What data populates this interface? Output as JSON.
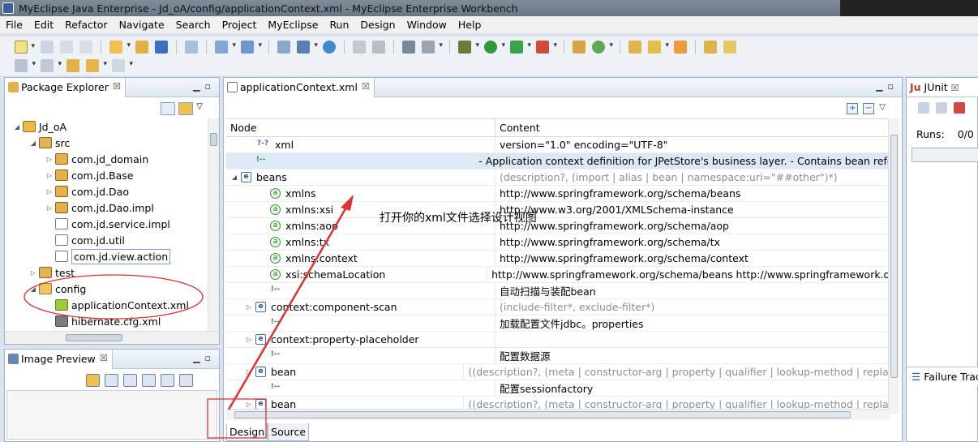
{
  "window": {
    "title": "MyEclipse Java Enterprise - Jd_oA/config/applicationContext.xml - MyEclipse Enterprise Workbench"
  },
  "menu": [
    "File",
    "Edit",
    "Refactor",
    "Navigate",
    "Search",
    "Project",
    "MyEclipse",
    "Run",
    "Design",
    "Window",
    "Help"
  ],
  "package_explorer": {
    "title": "Package Explorer",
    "close": "☒",
    "tree": [
      {
        "label": "Jd_oA",
        "indent": 0,
        "twisty": "◢",
        "icon": "project"
      },
      {
        "label": "src",
        "indent": 1,
        "twisty": "◢",
        "icon": "src"
      },
      {
        "label": "com.jd_domain",
        "indent": 2,
        "twisty": "▷",
        "icon": "pkg"
      },
      {
        "label": "com.jd.Base",
        "indent": 2,
        "twisty": "▷",
        "icon": "pkg"
      },
      {
        "label": "com.jd.Dao",
        "indent": 2,
        "twisty": "▷",
        "icon": "pkg"
      },
      {
        "label": "com.jd.Dao.impl",
        "indent": 2,
        "twisty": "▷",
        "icon": "pkg"
      },
      {
        "label": "com.jd.service.impl",
        "indent": 2,
        "twisty": "",
        "icon": "pkg-empty"
      },
      {
        "label": "com.jd.util",
        "indent": 2,
        "twisty": "",
        "icon": "pkg-empty"
      },
      {
        "label": "com.jd.view.action",
        "indent": 2,
        "twisty": "",
        "icon": "pkg-empty",
        "boxed": true
      },
      {
        "label": "test",
        "indent": 1,
        "twisty": "▷",
        "icon": "src"
      },
      {
        "label": "config",
        "indent": 1,
        "twisty": "◢",
        "icon": "folder"
      },
      {
        "label": "applicationContext.xml",
        "indent": 2,
        "twisty": "",
        "icon": "xml-leaf"
      },
      {
        "label": "hibernate.cfg.xml",
        "indent": 2,
        "twisty": "",
        "icon": "cfg"
      }
    ]
  },
  "image_preview": {
    "title": "Image Preview",
    "close": "☒"
  },
  "editor": {
    "tab_label": "applicationContext.xml",
    "close": "☒",
    "columns": [
      "Node",
      "Content"
    ],
    "rows": [
      {
        "indent": 1,
        "twisty": "",
        "icon": "?-?",
        "kind": "x",
        "node": "xml",
        "content": "version=\"1.0\" encoding=\"UTF-8\"",
        "grey": false
      },
      {
        "indent": 1,
        "twisty": "",
        "icon": "!--",
        "kind": "c",
        "node": "",
        "content": " - Application context definition for JPetStore's business layer. - Contains bean references",
        "grey": false,
        "selected": true
      },
      {
        "indent": 0,
        "twisty": "◢",
        "icon": "e",
        "kind": "e",
        "node": "beans",
        "content": "(description?, (import | alias | bean | namespace:uri=\"##other\")*)",
        "grey": true
      },
      {
        "indent": 2,
        "twisty": "",
        "icon": "a",
        "kind": "a",
        "node": "xmlns",
        "content": "http://www.springframework.org/schema/beans",
        "grey": false
      },
      {
        "indent": 2,
        "twisty": "",
        "icon": "a",
        "kind": "a",
        "node": "xmlns:xsi",
        "content": "http://www.w3.org/2001/XMLSchema-instance",
        "grey": false
      },
      {
        "indent": 2,
        "twisty": "",
        "icon": "a",
        "kind": "a",
        "node": "xmlns:aop",
        "content": "http://www.springframework.org/schema/aop",
        "grey": false
      },
      {
        "indent": 2,
        "twisty": "",
        "icon": "a",
        "kind": "a",
        "node": "xmlns:tx",
        "content": "http://www.springframework.org/schema/tx",
        "grey": false
      },
      {
        "indent": 2,
        "twisty": "",
        "icon": "a",
        "kind": "a",
        "node": "xmlns:context",
        "content": "http://www.springframework.org/schema/context",
        "grey": false
      },
      {
        "indent": 2,
        "twisty": "",
        "icon": "a",
        "kind": "a",
        "node": "xsi:schemaLocation",
        "content": "http://www.springframework.org/schema/beans http://www.springframework.org/",
        "grey": false
      },
      {
        "indent": 2,
        "twisty": "",
        "icon": "!--",
        "kind": "c",
        "node": "",
        "content": "自动扫描与装配bean",
        "grey": false
      },
      {
        "indent": 1,
        "twisty": "▷",
        "icon": "e",
        "kind": "e",
        "node": "context:component-scan",
        "content": "(include-filter*, exclude-filter*)",
        "grey": true
      },
      {
        "indent": 2,
        "twisty": "",
        "icon": "!--",
        "kind": "c",
        "node": "",
        "content": "加载配置文件jdbc。properties",
        "grey": false
      },
      {
        "indent": 1,
        "twisty": "▷",
        "icon": "e",
        "kind": "e",
        "node": "context:property-placeholder",
        "content": "",
        "grey": false
      },
      {
        "indent": 2,
        "twisty": "",
        "icon": "!--",
        "kind": "c",
        "node": "",
        "content": "配置数据源",
        "grey": false
      },
      {
        "indent": 1,
        "twisty": "▷",
        "icon": "e",
        "kind": "e",
        "node": "bean",
        "content": "((description?, (meta | constructor-arg | property | qualifier | lookup-method | replaced-method",
        "grey": true
      },
      {
        "indent": 2,
        "twisty": "",
        "icon": "!--",
        "kind": "c",
        "node": "",
        "content": "配置sessionfactory",
        "grey": false
      },
      {
        "indent": 1,
        "twisty": "▷",
        "icon": "e",
        "kind": "e",
        "node": "bean",
        "content": "((description?, (meta | constructor-arg | property | qualifier | lookup-method | replaced-method",
        "grey": true
      }
    ],
    "bottom_tabs": [
      "Design",
      "Source"
    ],
    "active_bottom_tab": "Design"
  },
  "annotation": {
    "text": "打开你的xml文件选择设计视图",
    "color": "#e03030"
  },
  "junit": {
    "title": "JUnit",
    "close": "☒",
    "runs_label": "Runs:",
    "runs_value": "0/0",
    "failure_trace": "Failure Trace"
  }
}
